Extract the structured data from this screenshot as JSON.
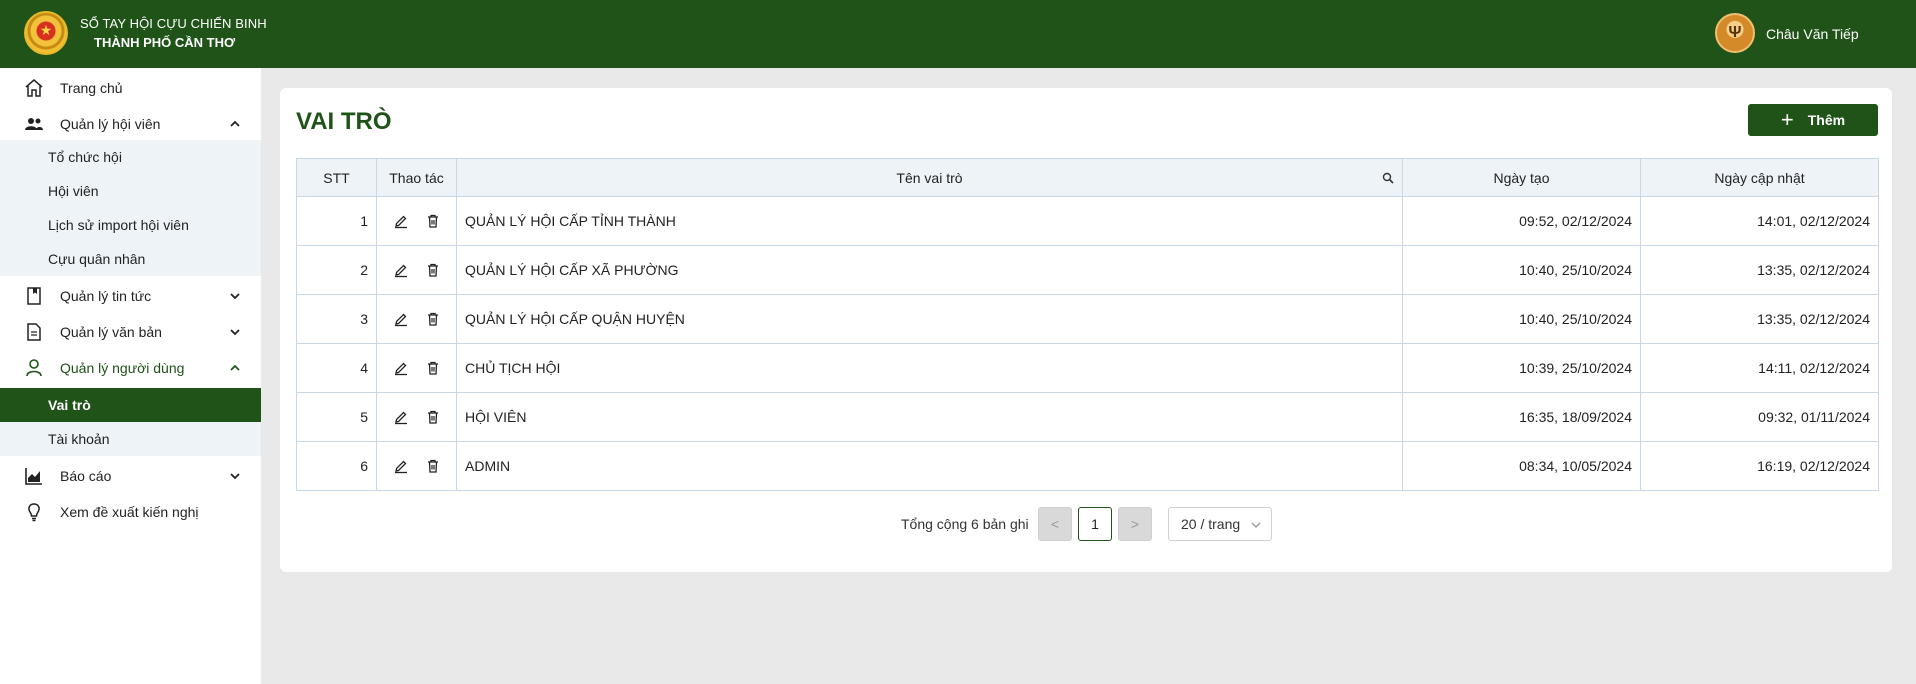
{
  "header": {
    "brand_line1": "SỔ TAY HỘI CỰU CHIẾN BINH",
    "brand_line2": "THÀNH PHỐ CẦN THƠ",
    "user_name": "Châu Văn Tiếp"
  },
  "sidebar": {
    "home": "Trang chủ",
    "members": "Quản lý hội viên",
    "members_sub": [
      "Tổ chức hội",
      "Hội viên",
      "Lịch sử import hội viên",
      "Cựu quân nhân"
    ],
    "news": "Quản lý tin tức",
    "docs": "Quản lý văn bản",
    "users": "Quản lý người dùng",
    "users_sub": [
      "Vai trò",
      "Tài khoản"
    ],
    "reports": "Báo cáo",
    "proposals": "Xem đề xuất kiến nghị"
  },
  "page": {
    "title": "VAI TRÒ",
    "add_label": "Thêm"
  },
  "table": {
    "headers": {
      "stt": "STT",
      "actions": "Thao tác",
      "name": "Tên vai trò",
      "created": "Ngày tạo",
      "updated": "Ngày cập nhật"
    },
    "rows": [
      {
        "stt": "1",
        "name": "QUẢN LÝ HỘI CẤP TỈNH THÀNH",
        "created": "09:52, 02/12/2024",
        "updated": "14:01, 02/12/2024"
      },
      {
        "stt": "2",
        "name": "QUẢN LÝ HỘI CẤP XÃ PHƯỜNG",
        "created": "10:40, 25/10/2024",
        "updated": "13:35, 02/12/2024"
      },
      {
        "stt": "3",
        "name": "QUẢN LÝ HỘI CẤP QUẬN HUYỆN",
        "created": "10:40, 25/10/2024",
        "updated": "13:35, 02/12/2024"
      },
      {
        "stt": "4",
        "name": "CHỦ TỊCH HỘI",
        "created": "10:39, 25/10/2024",
        "updated": "14:11, 02/12/2024"
      },
      {
        "stt": "5",
        "name": "HỘI VIÊN",
        "created": "16:35, 18/09/2024",
        "updated": "09:32, 01/11/2024"
      },
      {
        "stt": "6",
        "name": "ADMIN",
        "created": "08:34, 10/05/2024",
        "updated": "16:19, 02/12/2024"
      }
    ]
  },
  "pagination": {
    "total": "Tổng cộng 6 bản ghi",
    "prev": "<",
    "current": "1",
    "next": ">",
    "page_size": "20 / trang"
  },
  "colors": {
    "brand_green": "#1f5318",
    "table_header_bg": "#eef3f8"
  }
}
